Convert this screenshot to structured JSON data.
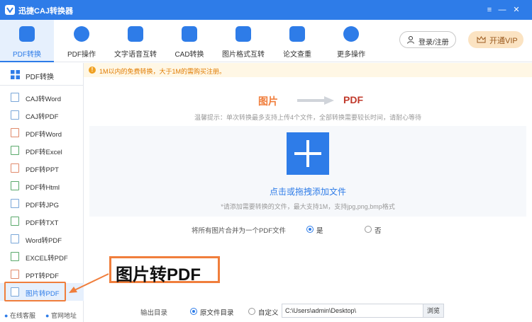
{
  "window": {
    "title": "迅捷CAJ转换器"
  },
  "toolbar": {
    "tools": [
      {
        "label": "PDF转换"
      },
      {
        "label": "PDF操作"
      },
      {
        "label": "文字语音互转"
      },
      {
        "label": "CAD转换"
      },
      {
        "label": "图片格式互转"
      },
      {
        "label": "论文查重"
      },
      {
        "label": "更多操作"
      }
    ],
    "login_label": "登录/注册",
    "vip_label": "开通VIP"
  },
  "sidebar": {
    "header": "PDF转换",
    "items": [
      {
        "label": "CAJ转Word"
      },
      {
        "label": "CAJ转PDF"
      },
      {
        "label": "PDF转Word"
      },
      {
        "label": "PDF转Excel"
      },
      {
        "label": "PDF转PPT"
      },
      {
        "label": "PDF转Html"
      },
      {
        "label": "PDF转JPG"
      },
      {
        "label": "PDF转TXT"
      },
      {
        "label": "Word转PDF"
      },
      {
        "label": "EXCEL转PDF"
      },
      {
        "label": "PPT转PDF"
      },
      {
        "label": "图片转PDF"
      }
    ],
    "footer": {
      "service": "在线客服",
      "website": "官网地址"
    }
  },
  "notice": {
    "text": "1M以内的免费转换，大于1M的需购买注册。"
  },
  "conversion": {
    "from": "图片",
    "to": "PDF"
  },
  "tip": "温馨提示：单次转换最多支持上传4个文件，全部转换需要较长时间，请耐心等待",
  "dropzone": {
    "label": "点击或拖拽添加文件",
    "hint": "*请添加需要转换的文件，最大支持1M，支持jpg,png,bmp格式"
  },
  "merge": {
    "question": "将所有图片合并为一个PDF文件",
    "yes": "是",
    "no": "否",
    "selected": "yes"
  },
  "callout": {
    "text": "图片转PDF"
  },
  "output": {
    "label": "输出目录",
    "option_source": "原文件目录",
    "option_custom": "自定义",
    "selected": "source",
    "path": "C:\\Users\\admin\\Desktop\\",
    "browse_label": "浏览"
  },
  "colors": {
    "accent": "#2e7ce8",
    "highlight": "#f07e3c",
    "warning": "#e07b00"
  }
}
